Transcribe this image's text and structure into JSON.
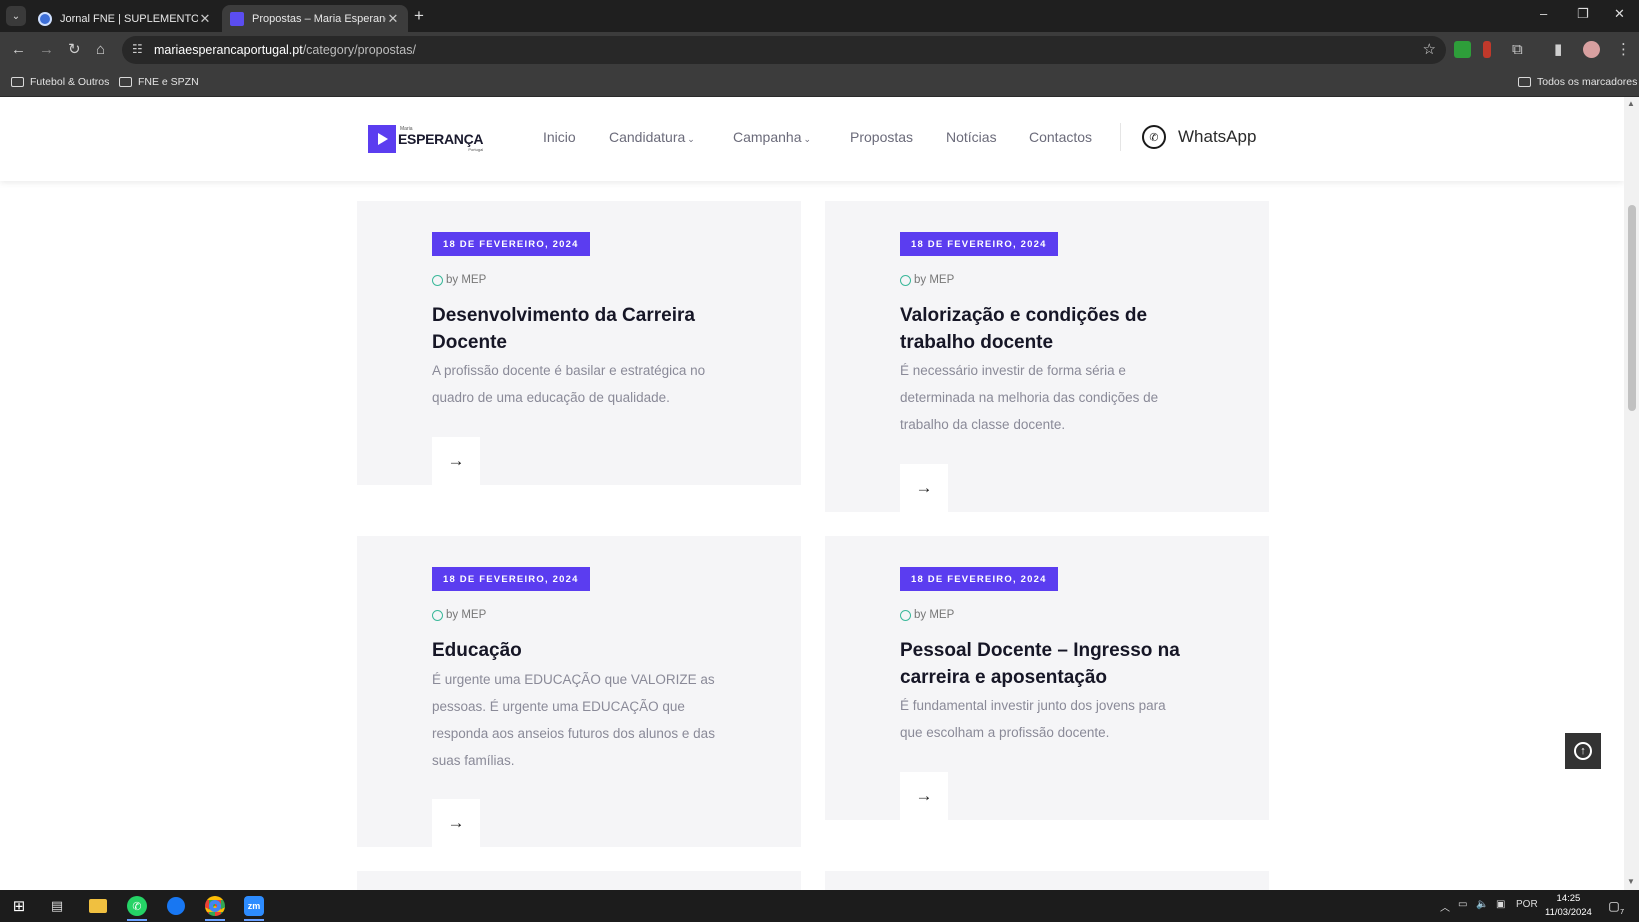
{
  "browser": {
    "tabs": [
      {
        "title": "Jornal FNE | SUPLEMENTO MEP",
        "active": false
      },
      {
        "title": "Propostas – Maria Esperança",
        "active": true
      }
    ],
    "url_host": "mariaesperancaportugal.pt",
    "url_path": "/category/propostas/",
    "bookmarks": [
      {
        "label": "Futebol & Outros"
      },
      {
        "label": "FNE e SPZN"
      }
    ],
    "all_bookmarks_label": "Todos os marcadores"
  },
  "site": {
    "logo": {
      "small": "Maria",
      "big": "ESPERANÇA",
      "sub": "Portugal"
    },
    "nav": [
      {
        "label": "Inicio"
      },
      {
        "label": "Candidatura",
        "caret": "⌄"
      },
      {
        "label": "Campanha",
        "caret": "⌄"
      },
      {
        "label": "Propostas"
      },
      {
        "label": "Notícias"
      },
      {
        "label": "Contactos"
      }
    ],
    "whatsapp_label": "WhatsApp",
    "accent_color": "#5b3df0",
    "posts": [
      {
        "date": "18 DE FEVEREIRO, 2024",
        "author": "by MEP",
        "title": "Desenvolvimento da Carreira Docente",
        "excerpt": "A profissão docente é basilar e estratégica no quadro de uma educação de qualidade."
      },
      {
        "date": "18 DE FEVEREIRO, 2024",
        "author": "by MEP",
        "title": "Valorização e condições de trabalho docente",
        "excerpt": "É necessário investir de forma séria e determinada na melhoria das condições de trabalho da classe docente."
      },
      {
        "date": "18 DE FEVEREIRO, 2024",
        "author": "by MEP",
        "title": "Educação",
        "excerpt": "É urgente uma EDUCAÇÃO que VALORIZE as pessoas. É urgente uma EDUCAÇÃO que responda aos anseios futuros dos alunos e das suas famílias."
      },
      {
        "date": "18 DE FEVEREIRO, 2024",
        "author": "by MEP",
        "title": "Pessoal Docente – Ingresso na carreira e aposentação",
        "excerpt": "É fundamental investir junto dos jovens para que escolham a profissão docente."
      }
    ]
  },
  "taskbar": {
    "language": "POR",
    "time": "14:25",
    "date": "11/03/2024",
    "notifications": "7"
  }
}
